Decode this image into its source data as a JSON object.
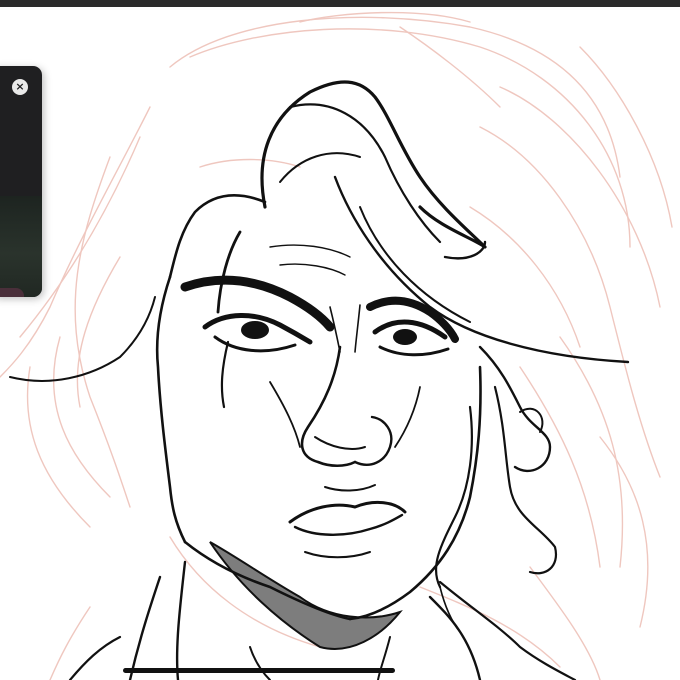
{
  "app": {
    "name": "",
    "mode": "drawing-canvas"
  },
  "reference_panel": {
    "close_icon": "close-icon",
    "close_glyph": "×"
  },
  "canvas": {
    "sketch_layer_color": "#efc7bf",
    "ink_layer_color": "#111111",
    "shadow_fill_color": "#7d7d7d",
    "background_color": "#ffffff"
  },
  "system": {
    "home_indicator": "home-indicator"
  }
}
